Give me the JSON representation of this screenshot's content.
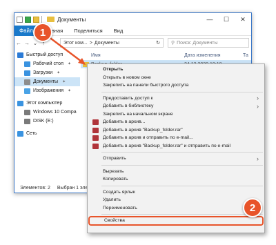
{
  "window": {
    "title": "Документы",
    "controls": {
      "minimize": "—",
      "maximize": "☐",
      "close": "✕"
    }
  },
  "ribbon": {
    "file": "Файл",
    "tabs": [
      "Главная",
      "Поделиться",
      "Вид"
    ]
  },
  "address": {
    "path_items": [
      "Этот ком...",
      ">",
      "Документы"
    ],
    "refresh": "↻",
    "search_placeholder": "Поиск: Документы"
  },
  "nav_pane": {
    "items": [
      {
        "label": "Быстрый доступ",
        "color": "#2b7bd6"
      },
      {
        "label": "Рабочий стол",
        "color": "#3a93e0",
        "pinned": true
      },
      {
        "label": "Загрузки",
        "color": "#3a93e0",
        "pinned": true
      },
      {
        "label": "Документы",
        "color": "#8d8d8d",
        "pinned": true,
        "selected": true
      },
      {
        "label": "Изображения",
        "color": "#4aa3e6",
        "pinned": true
      },
      {
        "label": "Этот компьютер",
        "color": "#3a93e0"
      },
      {
        "label": "Windows 10 Compa",
        "color": "#7a7a7a"
      },
      {
        "label": "DISK (E:)",
        "color": "#7a7a7a"
      },
      {
        "label": "Сеть",
        "color": "#3a93e0"
      }
    ],
    "pin_glyph": "📌"
  },
  "file_pane": {
    "columns": [
      "Имя",
      "Дата изменения",
      "Та"
    ],
    "row": {
      "name": "Backup_folder",
      "date": "24.12.2020 10:10"
    }
  },
  "status": {
    "count": "Элементов: 2",
    "selected": "Выбран 1 элем"
  },
  "callouts": {
    "one": "1",
    "two": "2"
  },
  "context_menu": {
    "open": "Открыть",
    "open_new_window": "Открыть в новом окне",
    "pin_quick_access": "Закрепить на панели быстрого доступа",
    "grant_access": "Предоставить доступ к",
    "add_library": "Добавить в библиотеку",
    "pin_start": "Закрепить на начальном экране",
    "add_archive": "Добавить в архив...",
    "add_to_rar": "Добавить в архив \"Backup_folder.rar\"",
    "add_email": "Добавить в архив и отправить по e-mail...",
    "add_rar_email": "Добавить в архив \"Backup_folder.rar\" и отправить по e-mail",
    "send_to": "Отправить",
    "cut": "Вырезать",
    "copy": "Копировать",
    "shortcut": "Создать ярлык",
    "delete": "Удалить",
    "rename": "Переименовать",
    "properties": "Свойства",
    "submenu_glyph": "›",
    "accent": "#e8542a"
  }
}
